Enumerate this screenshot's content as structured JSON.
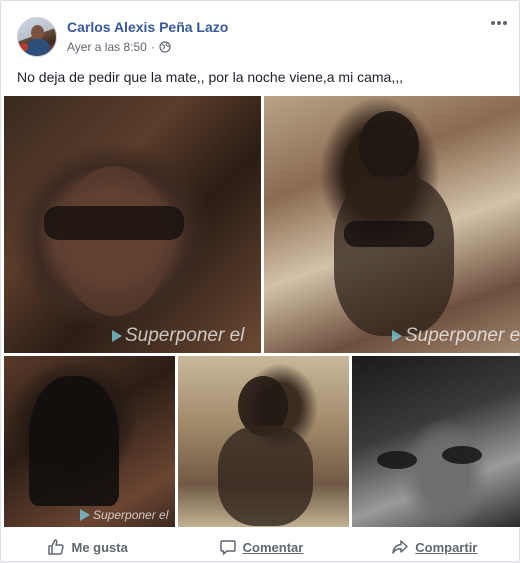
{
  "post": {
    "author": "Carlos Alexis Peña Lazo",
    "timestamp": "Ayer a las 8:50",
    "separator": "·",
    "privacy_icon": "globe-icon",
    "more_icon": "more-options-icon",
    "text": "No deja de pedir que la mate,, por la noche viene,a mi cama,,,"
  },
  "photos": [
    {
      "watermark": "Superponer el"
    },
    {
      "watermark": "Superponer el"
    },
    {
      "watermark": "Superponer el"
    },
    {
      "watermark": ""
    },
    {
      "watermark": ""
    }
  ],
  "actions": {
    "like_label": "Me gusta",
    "like_icon": "thumbs-up-icon",
    "comment_label": "Comentar",
    "comment_icon": "comment-icon",
    "share_label": "Compartir",
    "share_icon": "share-icon"
  },
  "colors": {
    "author_link": "#385898",
    "secondary_text": "#616770",
    "action_text": "#606770"
  }
}
